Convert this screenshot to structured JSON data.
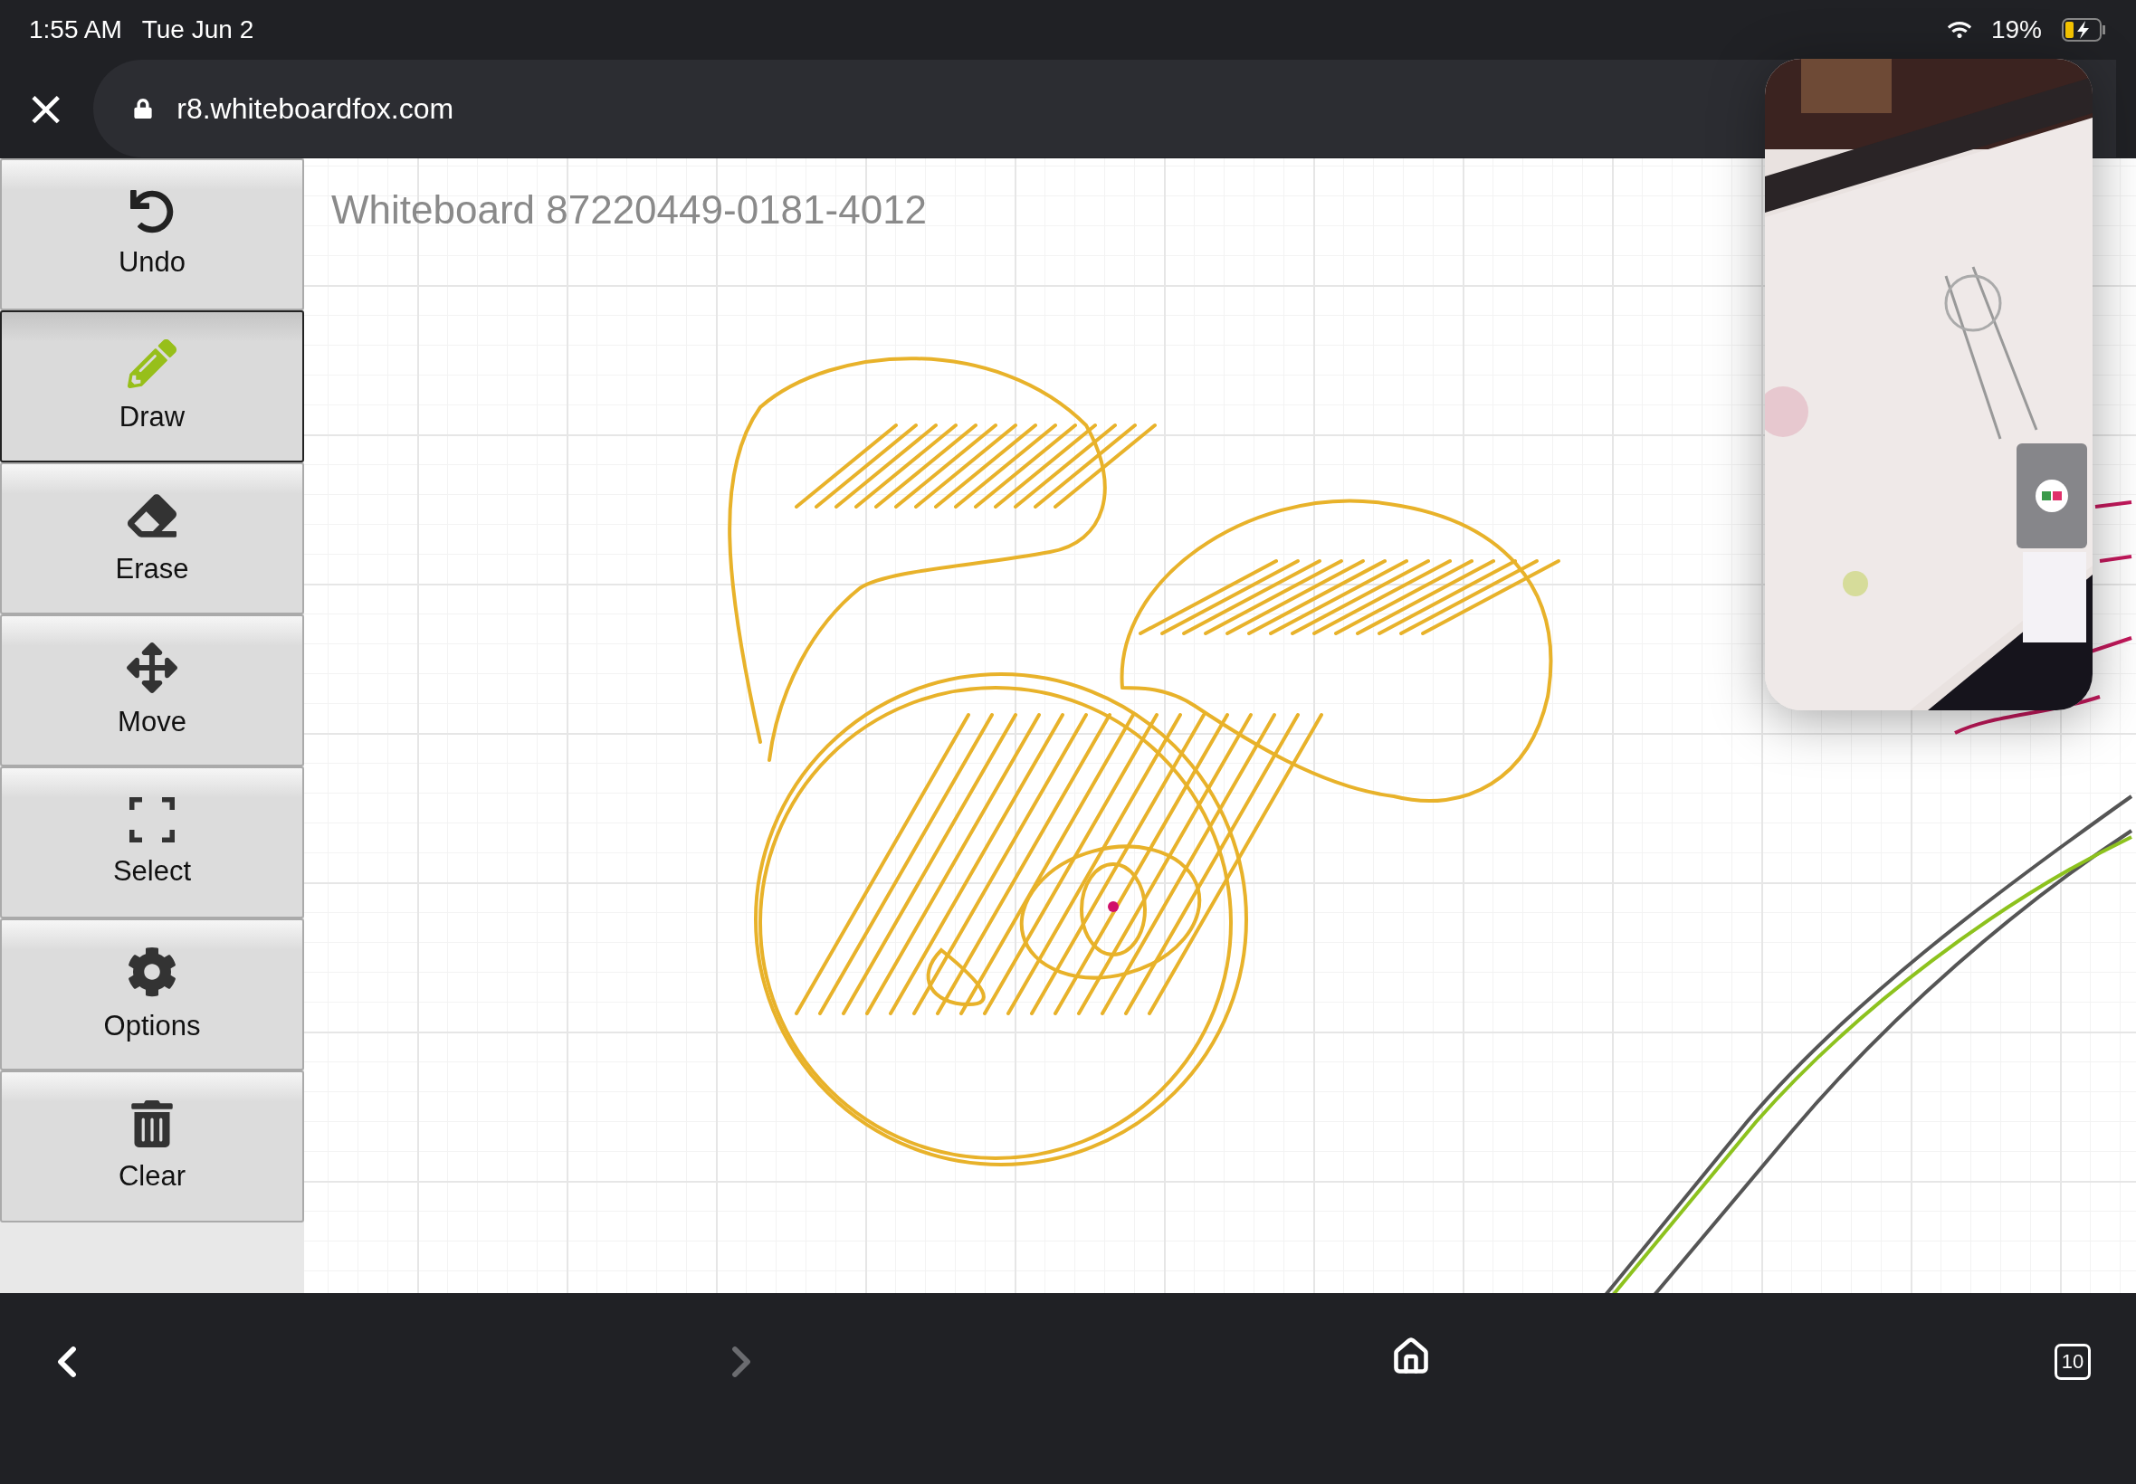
{
  "status_bar": {
    "time": "1:55 AM",
    "date": "Tue Jun 2",
    "battery": "19%",
    "charging": true
  },
  "address_bar": {
    "close": "×",
    "url": "r8.whiteboardfox.com"
  },
  "board": {
    "title": "Whiteboard 87220449-0181-4012"
  },
  "tools": [
    {
      "kind": "undo",
      "label": "Undo",
      "selected": false
    },
    {
      "kind": "draw",
      "label": "Draw",
      "selected": true
    },
    {
      "kind": "erase",
      "label": "Erase",
      "selected": false
    },
    {
      "kind": "move",
      "label": "Move",
      "selected": false
    },
    {
      "kind": "select",
      "label": "Select",
      "selected": false
    },
    {
      "kind": "options",
      "label": "Options",
      "selected": false
    },
    {
      "kind": "clear",
      "label": "Clear",
      "selected": false
    }
  ],
  "toolbar": {
    "back_disabled": false,
    "forward_disabled": true,
    "tab_count": "10"
  }
}
